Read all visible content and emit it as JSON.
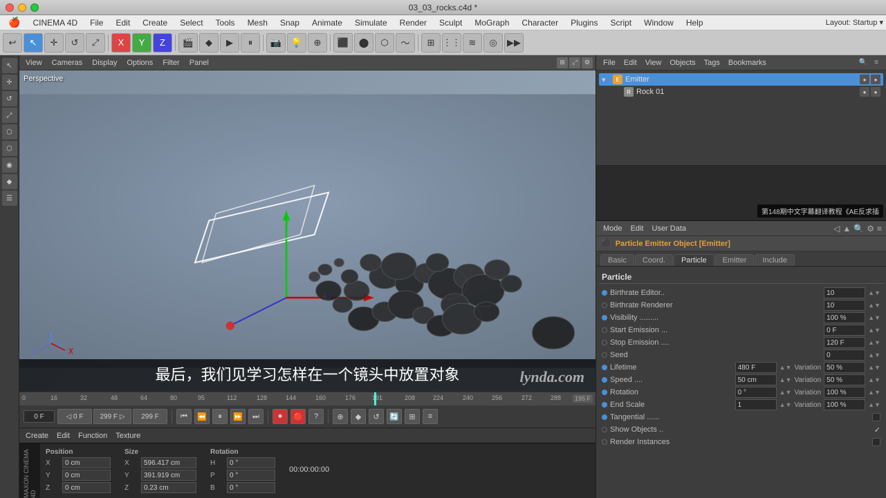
{
  "app": {
    "name": "CINEMA 4D",
    "file_title": "03_03_rocks.c4d *"
  },
  "title_bar": {
    "close": "●",
    "min": "●",
    "max": "●",
    "title": "03_03_rocks.c4d *"
  },
  "menu_bar": {
    "apple": "🍎",
    "items": [
      "CINEMA 4D",
      "File",
      "Edit",
      "Create",
      "Select",
      "Tools",
      "Mesh",
      "Snap",
      "Animate",
      "Simulate",
      "Render",
      "Sculpt",
      "MoGraph",
      "Character",
      "Plugins",
      "Script",
      "Window",
      "Help"
    ],
    "layout_label": "Layout:",
    "layout_value": "Startup"
  },
  "viewport": {
    "label": "Perspective",
    "toolbar_items": [
      "View",
      "Cameras",
      "Display",
      "Options",
      "Filter",
      "Panel"
    ]
  },
  "objects_panel": {
    "toolbar_items": [
      "File",
      "Edit",
      "View",
      "Objects",
      "Tags",
      "Bookmarks"
    ],
    "items": [
      {
        "name": "Emitter",
        "type": "emitter",
        "indent": 0
      },
      {
        "name": "Rock 01",
        "type": "rock",
        "indent": 1
      }
    ]
  },
  "content_notice": "第148期中文字幕翻译教程《AE反求插",
  "attributes_panel": {
    "toolbar_items": [
      "Mode",
      "Edit",
      "User Data"
    ],
    "title": "Particle Emitter Object [Emitter]",
    "tabs": [
      "Basic",
      "Coord.",
      "Particle",
      "Emitter",
      "Include"
    ],
    "active_tab": "Particle",
    "section": "Particle",
    "fields": [
      {
        "label": "Birthrate Editor...",
        "value": "10",
        "has_dot": true,
        "dot_color": "blue"
      },
      {
        "label": "Birthrate Renderer",
        "value": "10",
        "has_dot": false
      },
      {
        "label": "Visibility .........",
        "value": "100 %",
        "has_dot": true,
        "dot_color": "blue"
      },
      {
        "label": "Start Emission ...",
        "value": "0 F",
        "has_dot": false
      },
      {
        "label": "Stop Emission ...",
        "value": "120 F",
        "has_dot": false
      },
      {
        "label": "Seed",
        "value": "0",
        "has_dot": false
      },
      {
        "label": "Lifetime",
        "value": "480 F",
        "var_label": "Variation",
        "var_value": "50 %",
        "has_dot": true
      },
      {
        "label": "Speed ....",
        "value": "50 cm",
        "var_label": "Variation",
        "var_value": "50 %",
        "has_dot": true
      },
      {
        "label": "Rotation",
        "value": "0 °",
        "var_label": "Variation",
        "var_value": "100 %",
        "has_dot": true
      },
      {
        "label": "End Scale",
        "value": "1",
        "var_label": "Variation",
        "var_value": "100 %",
        "has_dot": true
      },
      {
        "label": "Tangential .....",
        "value": "",
        "has_dot": true,
        "dot_color": "blue",
        "is_check": true
      },
      {
        "label": "Show Objects ...",
        "value": "✓",
        "has_dot": false
      },
      {
        "label": "Render Instances",
        "value": "",
        "has_dot": false,
        "is_check": true
      }
    ]
  },
  "timeline": {
    "start": "0 F",
    "current": "0 F",
    "end": "299 F",
    "total": "299 F",
    "frame_display": "195 F",
    "marks": [
      "0",
      "16",
      "32",
      "48",
      "64",
      "80",
      "95",
      "112",
      "128",
      "144",
      "160",
      "176",
      "191",
      "208",
      "224",
      "240",
      "256",
      "272",
      "288"
    ]
  },
  "bottom_toolbar": {
    "items": [
      "Create",
      "Edit",
      "Function",
      "Texture"
    ]
  },
  "bottom_info": {
    "position_title": "Position",
    "size_title": "Size",
    "rotation_title": "Rotation",
    "x_pos": "0 cm",
    "y_pos": "0 cm",
    "z_pos": "0 cm",
    "x_size": "596.417 cm",
    "y_size": "391.919 cm",
    "h_rot": "0 °",
    "p_rot": "0 °",
    "b_rot": "0 °"
  },
  "subtitle": "最后，我们见学习怎样在一个镜头中放置对象",
  "watermark": "lynda.com",
  "sidebar_icons": [
    "▶",
    "◆",
    "◉",
    "⬡",
    "⬡",
    "☰",
    "⊕",
    "◎"
  ],
  "toolbar_icons": [
    "←",
    "↖",
    "⊕",
    "↺",
    "✚",
    "✕",
    "Y",
    "Z",
    "🎬",
    "▶",
    "⏸",
    "⏭",
    "📷",
    "✦",
    "●",
    "◈",
    "⊞",
    "◎",
    "☽",
    "💡"
  ]
}
